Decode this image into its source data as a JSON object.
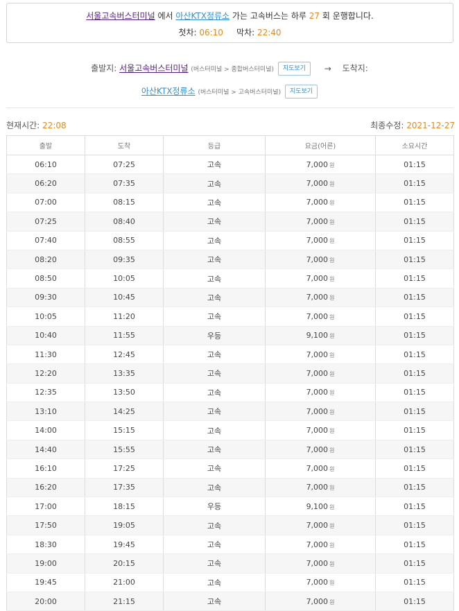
{
  "summary": {
    "departure": "서울고속버스터미널",
    "from_text": "에서",
    "arrival": "아산KTX정류소",
    "to_text": "가는 고속버스는 하루",
    "count": "27",
    "count_suffix": "회 운행합니다.",
    "first_label": "첫차:",
    "first_time": "06:10",
    "last_label": "막차:",
    "last_time": "22:40"
  },
  "route": {
    "dep_label": "출발지:",
    "dep_name": "서울고속버스터미널",
    "dep_path": "(버스터미널 > 종합버스터미널)",
    "arrow": "→",
    "arr_label": "도착지:",
    "arr_name": "아산KTX정류소",
    "arr_path": "(버스터미널 > 고속버스터미널)",
    "map_button": "지도보기"
  },
  "meta": {
    "now_label": "현재시간:",
    "now_time": "22:08",
    "updated_label": "최종수정:",
    "updated_date": "2021-12-27"
  },
  "table": {
    "headers": [
      "출발",
      "도착",
      "등급",
      "요금(어른)",
      "소요시간"
    ],
    "currency": "원",
    "rows": [
      [
        "06:10",
        "07:25",
        "고속",
        "7,000",
        "01:15"
      ],
      [
        "06:20",
        "07:35",
        "고속",
        "7,000",
        "01:15"
      ],
      [
        "07:00",
        "08:15",
        "고속",
        "7,000",
        "01:15"
      ],
      [
        "07:25",
        "08:40",
        "고속",
        "7,000",
        "01:15"
      ],
      [
        "07:40",
        "08:55",
        "고속",
        "7,000",
        "01:15"
      ],
      [
        "08:20",
        "09:35",
        "고속",
        "7,000",
        "01:15"
      ],
      [
        "08:50",
        "10:05",
        "고속",
        "7,000",
        "01:15"
      ],
      [
        "09:30",
        "10:45",
        "고속",
        "7,000",
        "01:15"
      ],
      [
        "10:05",
        "11:20",
        "고속",
        "7,000",
        "01:15"
      ],
      [
        "10:40",
        "11:55",
        "우등",
        "9,100",
        "01:15"
      ],
      [
        "11:30",
        "12:45",
        "고속",
        "7,000",
        "01:15"
      ],
      [
        "12:20",
        "13:35",
        "고속",
        "7,000",
        "01:15"
      ],
      [
        "12:35",
        "13:50",
        "고속",
        "7,000",
        "01:15"
      ],
      [
        "13:10",
        "14:25",
        "고속",
        "7,000",
        "01:15"
      ],
      [
        "14:00",
        "15:15",
        "고속",
        "7,000",
        "01:15"
      ],
      [
        "14:40",
        "15:55",
        "고속",
        "7,000",
        "01:15"
      ],
      [
        "16:10",
        "17:25",
        "고속",
        "7,000",
        "01:15"
      ],
      [
        "16:20",
        "17:35",
        "고속",
        "7,000",
        "01:15"
      ],
      [
        "17:00",
        "18:15",
        "우등",
        "9,100",
        "01:15"
      ],
      [
        "17:50",
        "19:05",
        "고속",
        "7,000",
        "01:15"
      ],
      [
        "18:30",
        "19:45",
        "고속",
        "7,000",
        "01:15"
      ],
      [
        "19:00",
        "20:15",
        "고속",
        "7,000",
        "01:15"
      ],
      [
        "19:45",
        "21:00",
        "고속",
        "7,000",
        "01:15"
      ],
      [
        "20:00",
        "21:15",
        "고속",
        "7,000",
        "01:15"
      ]
    ]
  }
}
